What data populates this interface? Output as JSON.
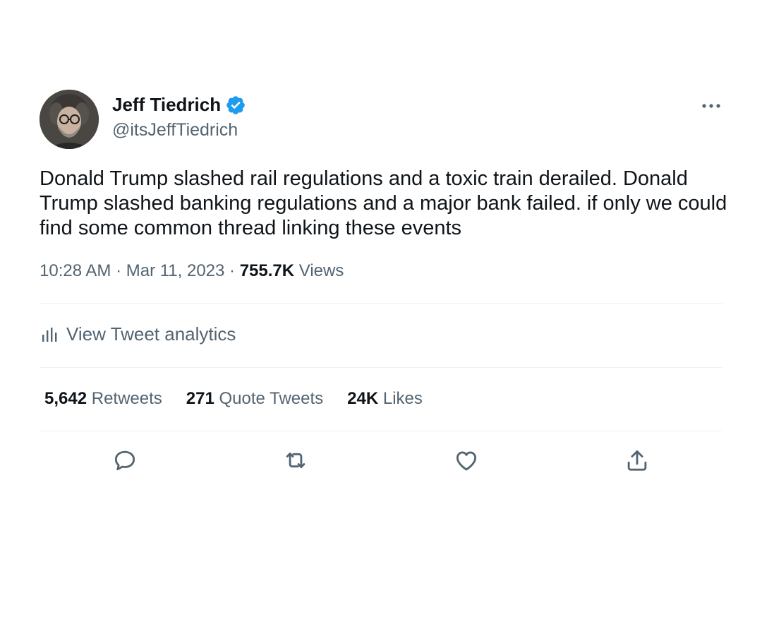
{
  "author": {
    "display_name": "Jeff Tiedrich",
    "handle": "@itsJeffTiedrich",
    "verified_icon": "verified-badge-icon",
    "avatar_icon": "avatar"
  },
  "tweet": {
    "text": "Donald Trump slashed rail regulations and a toxic train derailed. Donald Trump slashed banking regulations and a major bank failed. if only we could find some common thread linking these events",
    "time": "10:28 AM",
    "sep1": " · ",
    "date": "Mar 11, 2023",
    "sep2": " · ",
    "views_count": "755.7K",
    "views_label": "Views"
  },
  "analytics": {
    "label": "View Tweet analytics",
    "icon": "bar-chart-icon"
  },
  "stats": {
    "retweets_count": "5,642",
    "retweets_label": "Retweets",
    "quotes_count": "271",
    "quotes_label": "Quote Tweets",
    "likes_count": "24K",
    "likes_label": "Likes"
  },
  "actions": {
    "icons": [
      "reply-icon",
      "retweet-icon",
      "like-icon",
      "share-icon"
    ]
  },
  "more_icon": "more-options-icon",
  "colors": {
    "text_primary": "#0f1419",
    "text_secondary": "#536471",
    "verified_blue": "#1d9bf0",
    "divider": "#eff3f4"
  }
}
